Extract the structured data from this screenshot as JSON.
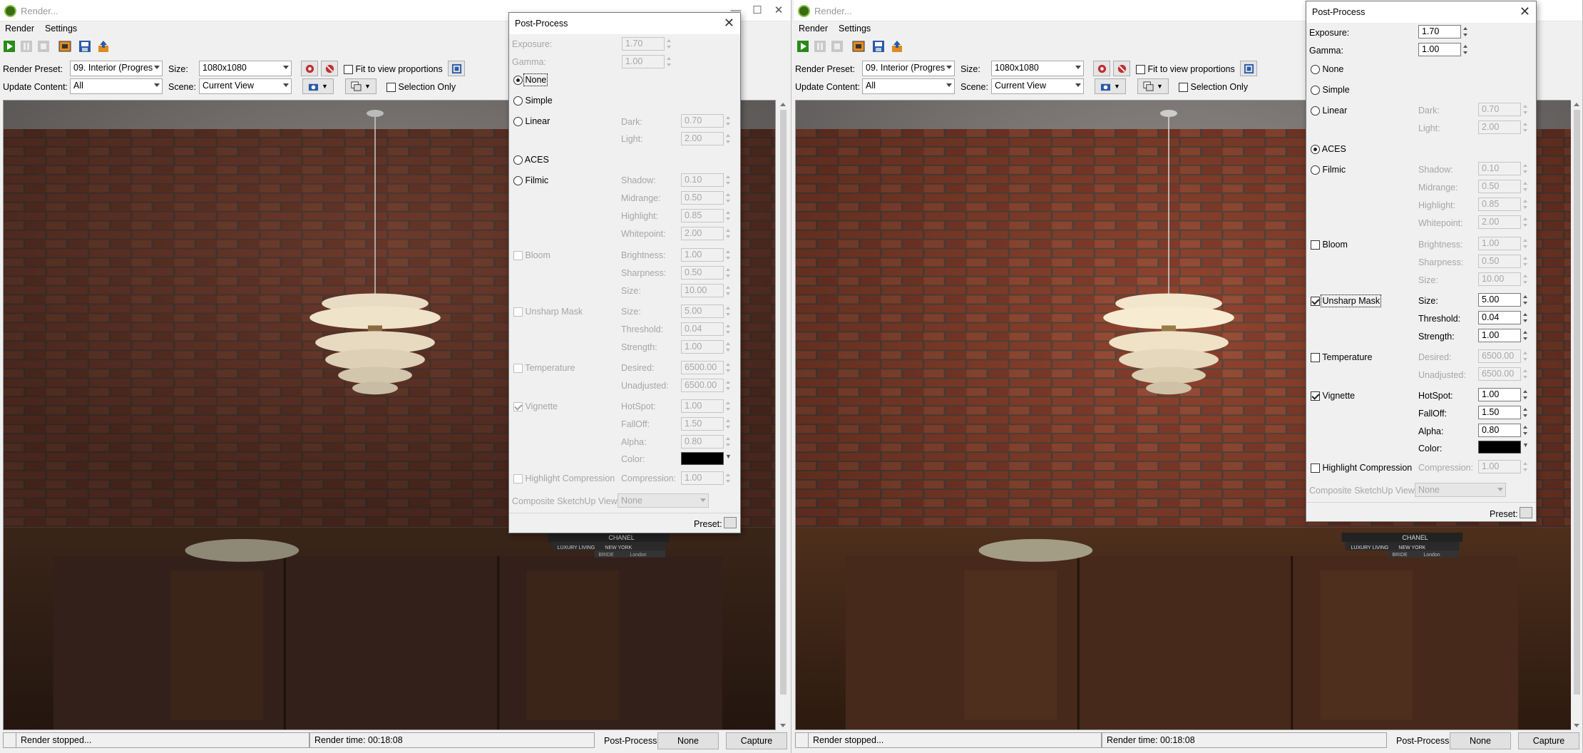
{
  "left": {
    "title": "Render...",
    "menu": [
      "Render",
      "Settings"
    ],
    "options": {
      "render_preset_label": "Render Preset:",
      "render_preset_value": "09. Interior (Progres",
      "size_label": "Size:",
      "size_value": "1080x1080",
      "fit_label": "Fit to view proportions",
      "update_label": "Update Content:",
      "update_value": "All",
      "scene_label": "Scene:",
      "scene_value": "Current View",
      "selection_label": "Selection Only"
    },
    "status": {
      "message": "Render stopped...",
      "time": "Render time: 00:18:08",
      "pp_label": "Post-Process:",
      "pp_value": "None",
      "capture": "Capture"
    },
    "postprocess": {
      "title": "Post-Process",
      "exposure_label": "Exposure:",
      "exposure": "1.70",
      "gamma_label": "Gamma:",
      "gamma": "1.00",
      "none": "None",
      "simple": "Simple",
      "linear": "Linear",
      "aces": "ACES",
      "filmic": "Filmic",
      "dark_label": "Dark:",
      "dark": "0.70",
      "light_label": "Light:",
      "light": "2.00",
      "shadow_label": "Shadow:",
      "shadow": "0.10",
      "midrange_label": "Midrange:",
      "midrange": "0.50",
      "highlight_label": "Highlight:",
      "highlight": "0.85",
      "whitepoint_label": "Whitepoint:",
      "whitepoint": "2.00",
      "bloom": "Bloom",
      "brightness_label": "Brightness:",
      "brightness": "1.00",
      "sharpness_label": "Sharpness:",
      "sharpness": "0.50",
      "bsize_label": "Size:",
      "bsize": "10.00",
      "unsharp": "Unsharp Mask",
      "usize_label": "Size:",
      "usize": "5.00",
      "threshold_label": "Threshold:",
      "threshold": "0.04",
      "strength_label": "Strength:",
      "strength": "1.00",
      "temperature": "Temperature",
      "desired_label": "Desired:",
      "desired": "6500.00",
      "unadjusted_label": "Unadjusted:",
      "unadjusted": "6500.00",
      "vignette": "Vignette",
      "hotspot_label": "HotSpot:",
      "hotspot": "1.00",
      "falloff_label": "FallOff:",
      "falloff": "1.50",
      "alpha_label": "Alpha:",
      "alpha": "0.80",
      "color_label": "Color:",
      "hc": "Highlight Compression",
      "compression_label": "Compression:",
      "compression": "1.00",
      "composite_label": "Composite SketchUp View:",
      "composite_value": "None",
      "preset_label": "Preset:"
    }
  },
  "right": {
    "title": "Render...",
    "menu": [
      "Render",
      "Settings"
    ],
    "options": {
      "render_preset_label": "Render Preset:",
      "render_preset_value": "09. Interior (Progres",
      "size_label": "Size:",
      "size_value": "1080x1080",
      "fit_label": "Fit to view proportions",
      "update_label": "Update Content:",
      "update_value": "All",
      "scene_label": "Scene:",
      "scene_value": "Current View",
      "selection_label": "Selection Only"
    },
    "status": {
      "message": "Render stopped...",
      "time": "Render time: 00:18:08",
      "pp_label": "Post-Process:",
      "pp_value": "None",
      "capture": "Capture"
    },
    "postprocess": {
      "title": "Post-Process",
      "exposure_label": "Exposure:",
      "exposure": "1.70",
      "gamma_label": "Gamma:",
      "gamma": "1.00",
      "none": "None",
      "simple": "Simple",
      "linear": "Linear",
      "aces": "ACES",
      "filmic": "Filmic",
      "dark_label": "Dark:",
      "dark": "0.70",
      "light_label": "Light:",
      "light": "2.00",
      "shadow_label": "Shadow:",
      "shadow": "0.10",
      "midrange_label": "Midrange:",
      "midrange": "0.50",
      "highlight_label": "Highlight:",
      "highlight": "0.85",
      "whitepoint_label": "Whitepoint:",
      "whitepoint": "2.00",
      "bloom": "Bloom",
      "brightness_label": "Brightness:",
      "brightness": "1.00",
      "sharpness_label": "Sharpness:",
      "sharpness": "0.50",
      "bsize_label": "Size:",
      "bsize": "10.00",
      "unsharp": "Unsharp Mask",
      "usize_label": "Size:",
      "usize": "5.00",
      "threshold_label": "Threshold:",
      "threshold": "0.04",
      "strength_label": "Strength:",
      "strength": "1.00",
      "temperature": "Temperature",
      "desired_label": "Desired:",
      "desired": "6500.00",
      "unadjusted_label": "Unadjusted:",
      "unadjusted": "6500.00",
      "vignette": "Vignette",
      "hotspot_label": "HotSpot:",
      "hotspot": "1.00",
      "falloff_label": "FallOff:",
      "falloff": "1.50",
      "alpha_label": "Alpha:",
      "alpha": "0.80",
      "color_label": "Color:",
      "hc": "Highlight Compression",
      "compression_label": "Compression:",
      "compression": "1.00",
      "composite_label": "Composite SketchUp View:",
      "composite_value": "None",
      "preset_label": "Preset:"
    }
  },
  "scene_text": {
    "book_top": "CHANEL",
    "book_mid_left": "LUXURY LIVING",
    "book_mid_right": "NEW YORK",
    "book_bottom_a": "BRIDE",
    "book_bottom_b": "London"
  },
  "colors": {
    "brick": "#8a3f2d",
    "mortar": "#5b4a40",
    "ceiling": "#a09a98",
    "wood": "#3b2517",
    "accent_green": "#3a6b12"
  }
}
